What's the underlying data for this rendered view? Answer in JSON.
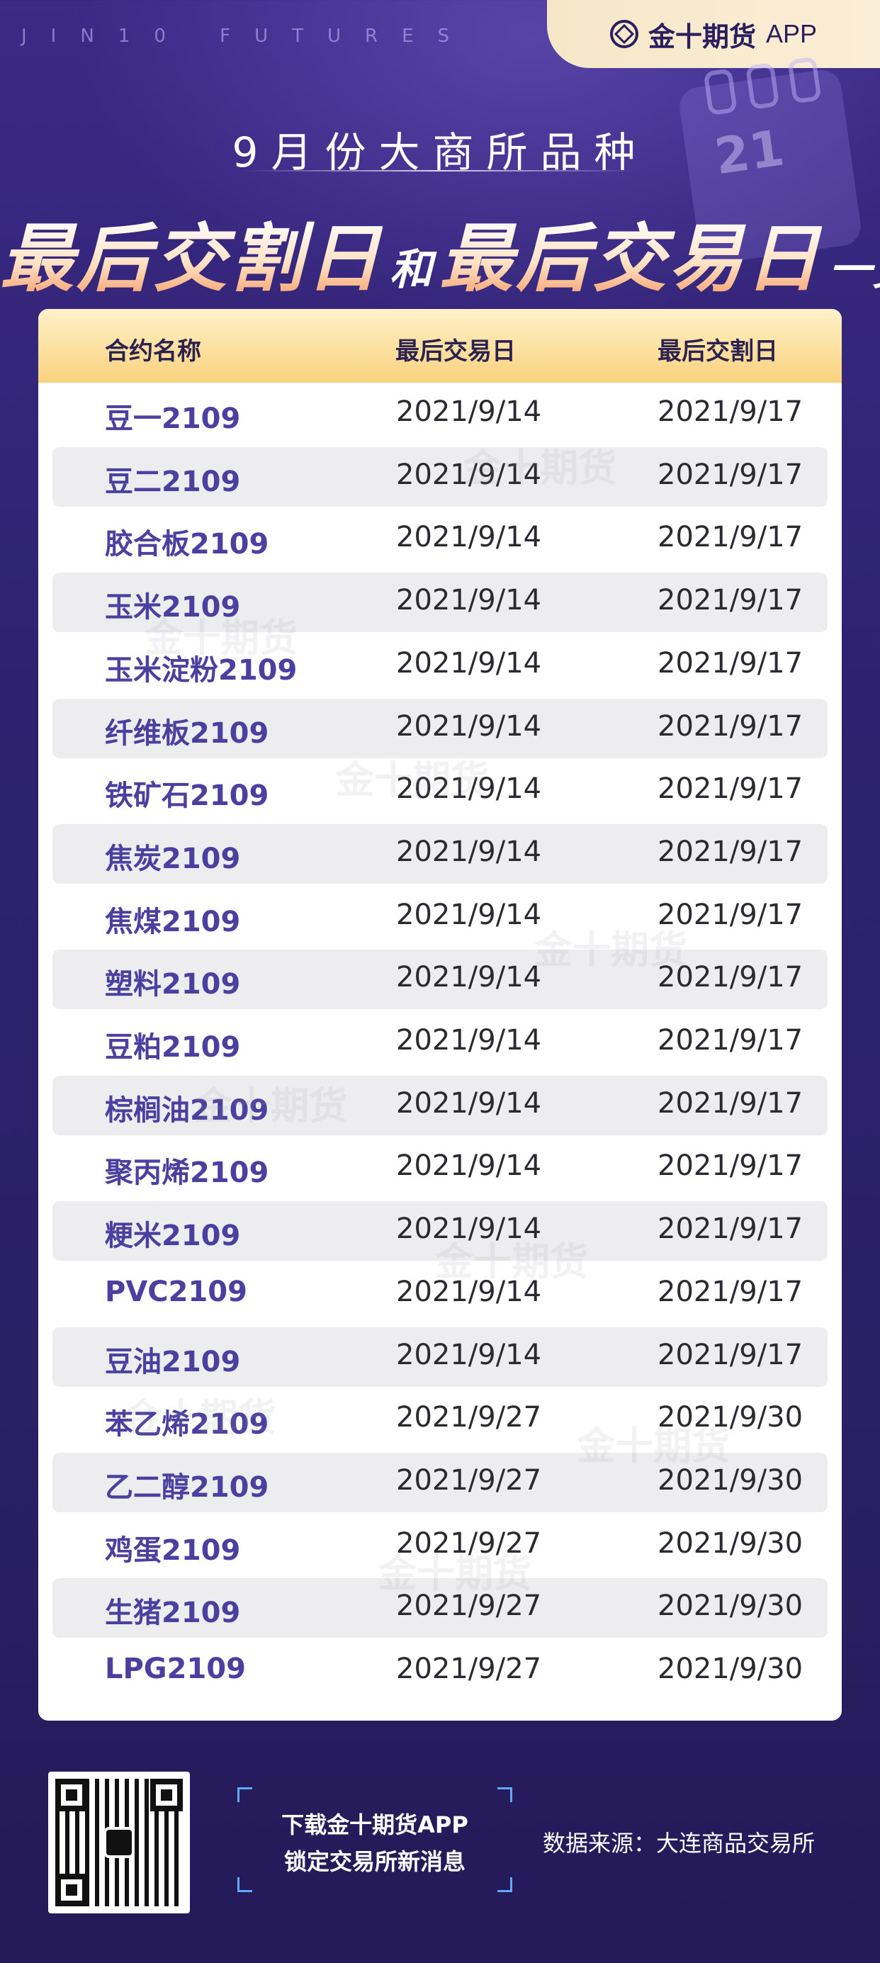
{
  "brand": {
    "letters": "JIN10 FUTURES",
    "logo_name": "金十期货",
    "logo_app": "APP"
  },
  "decor": {
    "calendar_number": "21"
  },
  "title": {
    "subtitle": "9月份大商所品种",
    "headline_part1": "最后交割日",
    "headline_join": "和",
    "headline_part2": "最后交易日",
    "headline_suffix": "一览"
  },
  "table": {
    "columns": [
      "合约名称",
      "最后交易日",
      "最后交割日"
    ],
    "rows": [
      {
        "name": "豆一2109",
        "last_trade": "2021/9/14",
        "last_delivery": "2021/9/17"
      },
      {
        "name": "豆二2109",
        "last_trade": "2021/9/14",
        "last_delivery": "2021/9/17"
      },
      {
        "name": "胶合板2109",
        "last_trade": "2021/9/14",
        "last_delivery": "2021/9/17"
      },
      {
        "name": "玉米2109",
        "last_trade": "2021/9/14",
        "last_delivery": "2021/9/17"
      },
      {
        "name": "玉米淀粉2109",
        "last_trade": "2021/9/14",
        "last_delivery": "2021/9/17"
      },
      {
        "name": "纤维板2109",
        "last_trade": "2021/9/14",
        "last_delivery": "2021/9/17"
      },
      {
        "name": "铁矿石2109",
        "last_trade": "2021/9/14",
        "last_delivery": "2021/9/17"
      },
      {
        "name": "焦炭2109",
        "last_trade": "2021/9/14",
        "last_delivery": "2021/9/17"
      },
      {
        "name": "焦煤2109",
        "last_trade": "2021/9/14",
        "last_delivery": "2021/9/17"
      },
      {
        "name": "塑料2109",
        "last_trade": "2021/9/14",
        "last_delivery": "2021/9/17"
      },
      {
        "name": "豆粕2109",
        "last_trade": "2021/9/14",
        "last_delivery": "2021/9/17"
      },
      {
        "name": "棕榈油2109",
        "last_trade": "2021/9/14",
        "last_delivery": "2021/9/17"
      },
      {
        "name": "聚丙烯2109",
        "last_trade": "2021/9/14",
        "last_delivery": "2021/9/17"
      },
      {
        "name": "粳米2109",
        "last_trade": "2021/9/14",
        "last_delivery": "2021/9/17"
      },
      {
        "name": "PVC2109",
        "last_trade": "2021/9/14",
        "last_delivery": "2021/9/17"
      },
      {
        "name": "豆油2109",
        "last_trade": "2021/9/14",
        "last_delivery": "2021/9/17"
      },
      {
        "name": "苯乙烯2109",
        "last_trade": "2021/9/27",
        "last_delivery": "2021/9/30"
      },
      {
        "name": "乙二醇2109",
        "last_trade": "2021/9/27",
        "last_delivery": "2021/9/30"
      },
      {
        "name": "鸡蛋2109",
        "last_trade": "2021/9/27",
        "last_delivery": "2021/9/30"
      },
      {
        "name": "生猪2109",
        "last_trade": "2021/9/27",
        "last_delivery": "2021/9/30"
      },
      {
        "name": "LPG2109",
        "last_trade": "2021/9/27",
        "last_delivery": "2021/9/30"
      }
    ]
  },
  "watermark": "金十期货",
  "footer": {
    "cta_line1": "下载金十期货APP",
    "cta_line2": "锁定交易所新消息",
    "source": "数据来源：大连商品交易所"
  },
  "colors": {
    "background": "#2e2270",
    "header_gold": "#f9d27e",
    "name_purple": "#4b3fa0",
    "headline_orange": "#f59a66",
    "corner_blue": "#5fa9ff"
  },
  "icons": [
    "logo-icon",
    "qr-code"
  ]
}
